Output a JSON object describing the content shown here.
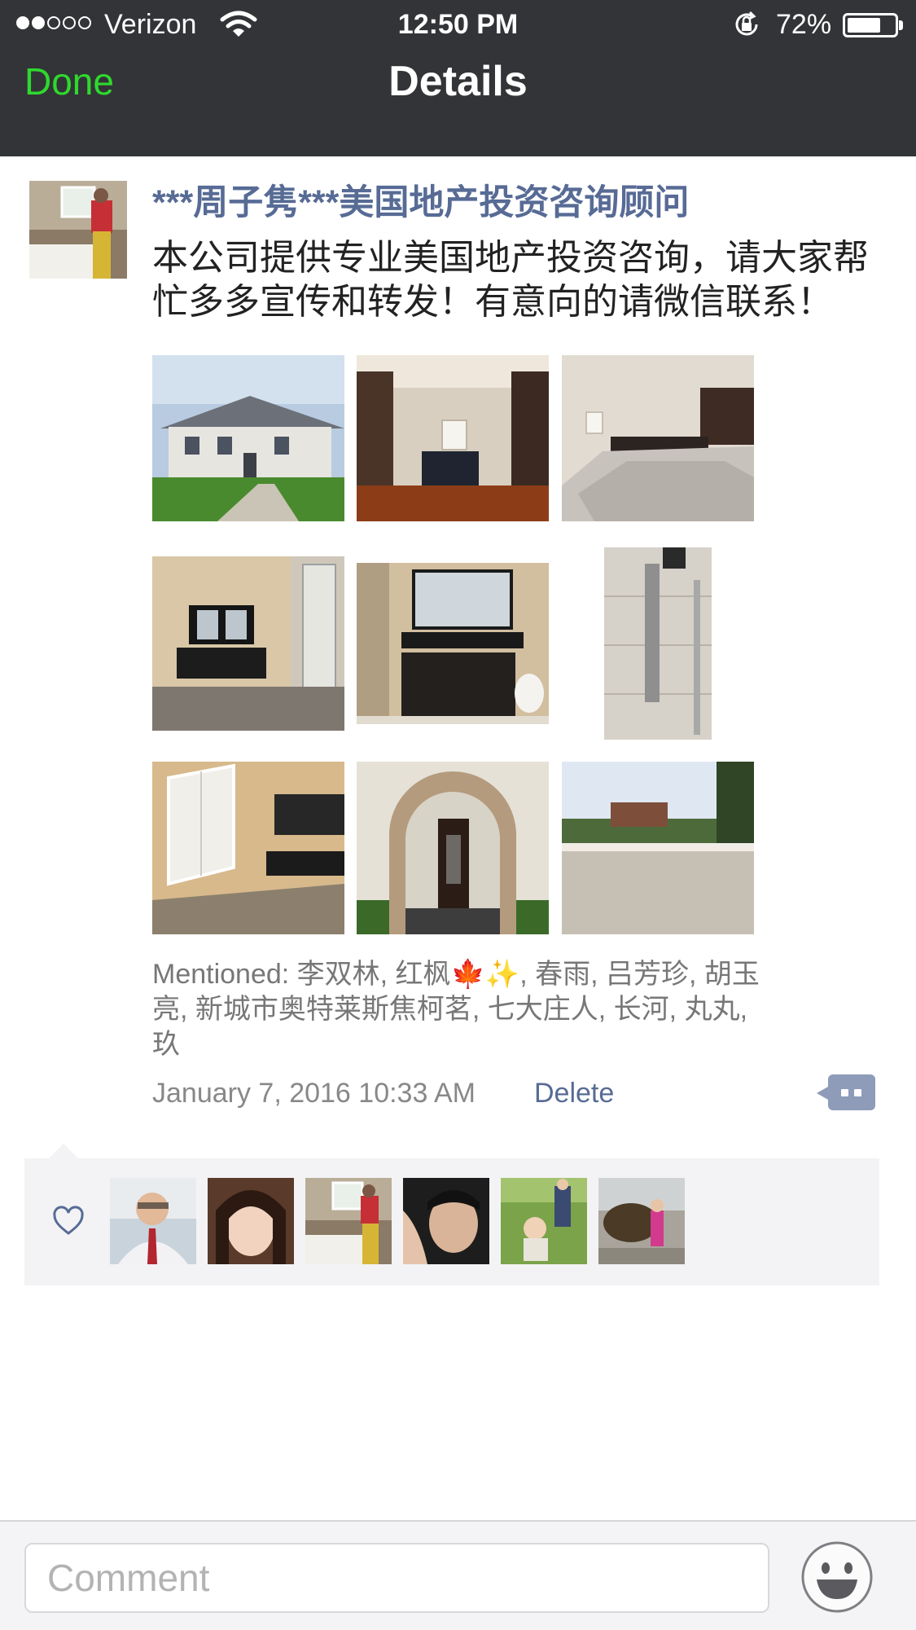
{
  "status_bar": {
    "carrier": "Verizon",
    "time": "12:50 PM",
    "battery_percent": "72%",
    "battery_level": 0.72,
    "signal_bars_filled": 2,
    "signal_bars_total": 5
  },
  "nav": {
    "done_label": "Done",
    "title": "Details"
  },
  "post": {
    "author": "***周子隽***美国地产投资咨询顾问",
    "text": "本公司提供专业美国地产投资咨询，请大家帮忙多多宣传和转发！有意向的请微信联系！",
    "images": [
      {
        "icon": "house-exterior-photo"
      },
      {
        "icon": "kitchen-photo"
      },
      {
        "icon": "kitchen-counter-photo"
      },
      {
        "icon": "bathroom-vanity-photo"
      },
      {
        "icon": "bathroom-sink-photo"
      },
      {
        "icon": "shower-panel-photo"
      },
      {
        "icon": "bathroom-window-photo"
      },
      {
        "icon": "front-door-photo"
      },
      {
        "icon": "backyard-deck-photo"
      }
    ],
    "mentioned": "Mentioned: 李双林, 红枫🍁✨, 春雨, 吕芳珍, 胡玉亮, 新城市奥特莱斯焦柯茗, 七大庄人, 长河, 丸丸, 玖",
    "timestamp": "January 7, 2016 10:33 AM",
    "delete_label": "Delete"
  },
  "likes": {
    "icon": "heart-icon",
    "users": [
      {
        "icon": "avatar-man-suit"
      },
      {
        "icon": "avatar-woman-selfie"
      },
      {
        "icon": "avatar-bathroom"
      },
      {
        "icon": "avatar-man-selfie"
      },
      {
        "icon": "avatar-child-grass"
      },
      {
        "icon": "avatar-bull-statue"
      }
    ]
  },
  "comment_bar": {
    "placeholder": "Comment",
    "emoji_icon": "smiley-icon"
  },
  "colors": {
    "nav_background": "#333437",
    "done_green": "#2ed92e",
    "link_blue": "#576b95",
    "likes_background": "#f3f3f5"
  }
}
